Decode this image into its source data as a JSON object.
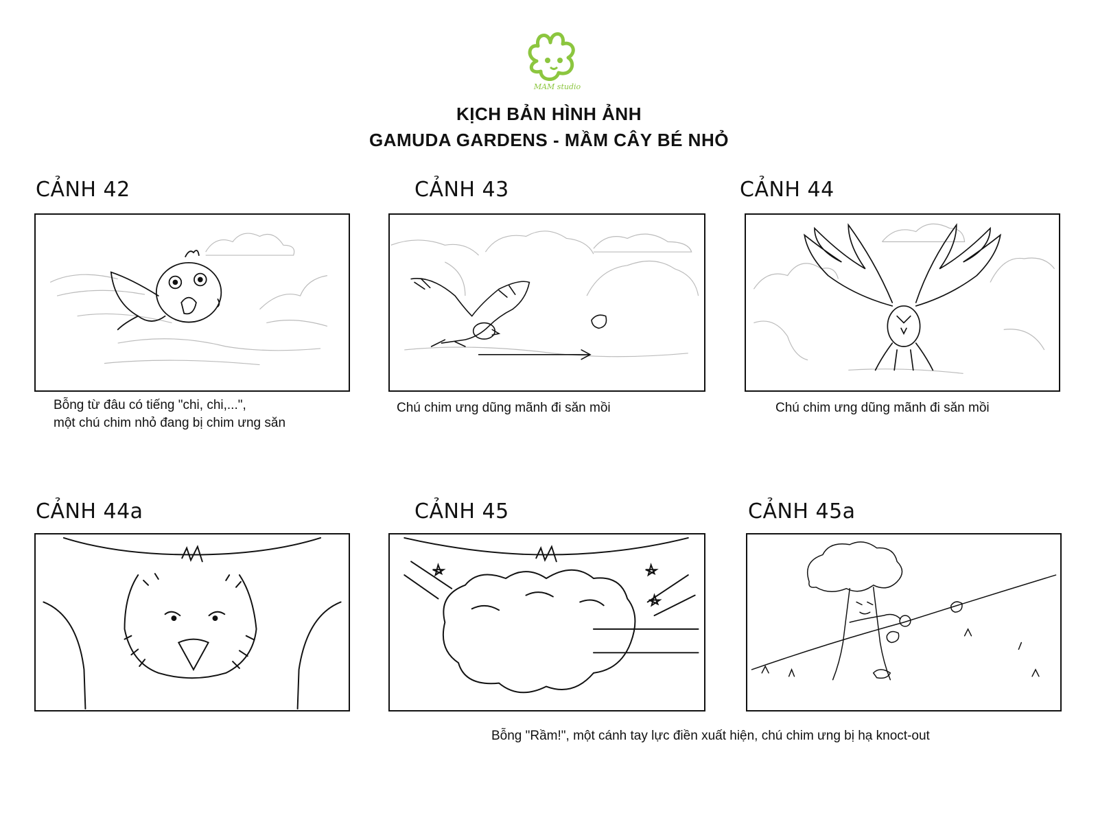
{
  "header": {
    "studio_logo_text": "MAM studio",
    "title_line1": "KỊCH BẢN HÌNH ẢNH",
    "title_line2": "GAMUDA GARDENS  - MẦM CÂY BÉ NHỎ"
  },
  "scenes": [
    {
      "label": "CẢNH 42",
      "caption_line1": "Bỗng từ đâu có tiếng \"chi, chi,...\",",
      "caption_line2": "một chú chim nhỏ đang bị chim ưng săn"
    },
    {
      "label": "CẢNH 43",
      "caption_line1": "Chú chim ưng dũng mãnh đi săn mồi"
    },
    {
      "label": "CẢNH 44",
      "caption_line1": "Chú chim ưng dũng mãnh đi săn mồi"
    },
    {
      "label": "CẢNH 44a"
    },
    {
      "label": "CẢNH 45"
    },
    {
      "label": "CẢNH 45a"
    }
  ],
  "bottom_caption": "Bỗng \"Rầm!\", một cánh tay lực điền xuất hiện, chú chim ưng bị hạ knoct-out",
  "colors": {
    "logo_green": "#8cc63f",
    "ink": "#111111"
  }
}
